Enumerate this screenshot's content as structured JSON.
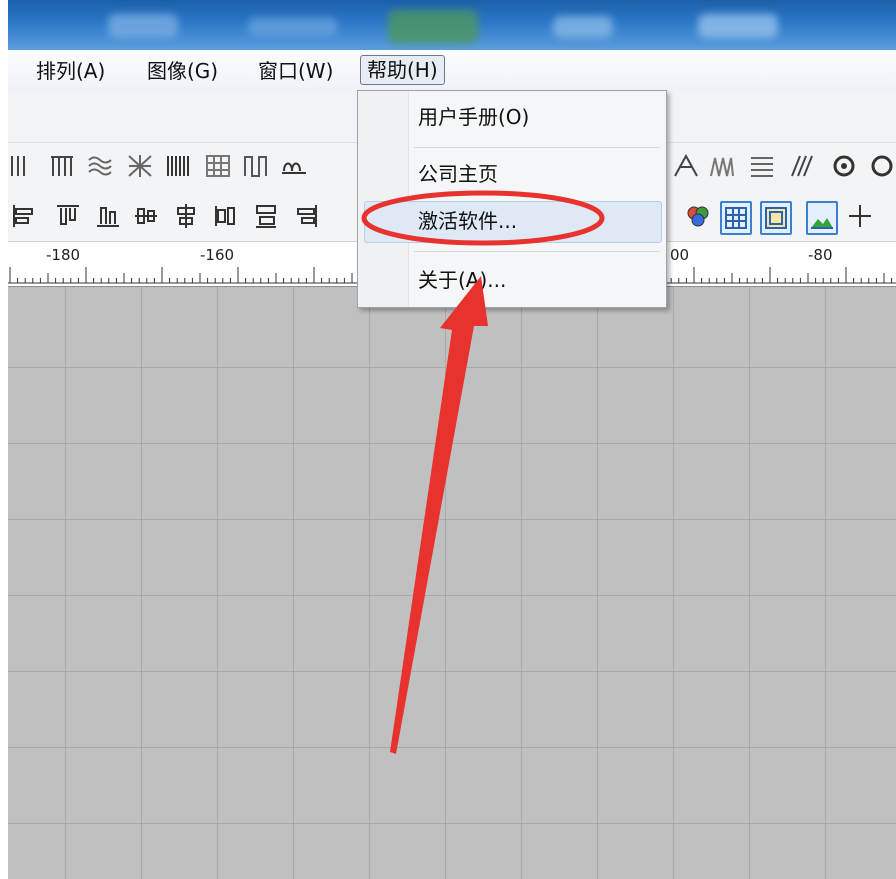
{
  "menubar": {
    "items": [
      {
        "label": "排列(A)"
      },
      {
        "label": "图像(G)"
      },
      {
        "label": "窗口(W)"
      },
      {
        "label": "帮助(H)"
      }
    ]
  },
  "help_menu": {
    "items": [
      {
        "label": "用户手册(O)"
      },
      {
        "label": "公司主页"
      },
      {
        "label": "激活软件..."
      },
      {
        "label": "关于(A)..."
      }
    ]
  },
  "ruler": {
    "labels": [
      "-180",
      "-160",
      "00",
      "-80"
    ]
  },
  "colors": {
    "annotation": "#e8322e",
    "canvas": "#c0c0c0",
    "grid": "#a9a9a9"
  }
}
